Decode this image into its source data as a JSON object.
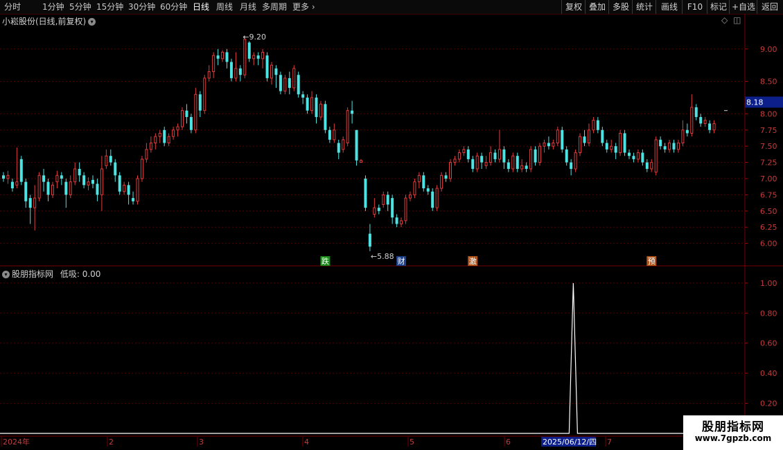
{
  "toolbar": {
    "periods": [
      "分时",
      "1分钟",
      "5分钟",
      "15分钟",
      "30分钟",
      "60分钟",
      "日线",
      "周线",
      "月线",
      "多周期",
      "更多"
    ],
    "active": "日线",
    "right_buttons": [
      "复权",
      "叠加",
      "多股",
      "统计",
      "画线",
      "F10",
      "标记",
      "+自选",
      "返回"
    ]
  },
  "main_chart": {
    "title": "小崧股份(日线,前复权)",
    "y_ticks": [
      "9.00",
      "8.50",
      "8.00",
      "7.75",
      "7.50",
      "7.25",
      "7.00",
      "6.75",
      "6.50",
      "6.25",
      "6.00"
    ],
    "current_price": "8.18",
    "high_label": "9.20",
    "low_label": "5.88",
    "event_tags": [
      {
        "text": "跌",
        "color": "#1a8a1a"
      },
      {
        "text": "财",
        "color": "#1c3f8c"
      },
      {
        "text": "激",
        "color": "#b0541a"
      },
      {
        "text": "预",
        "color": "#b0541a"
      }
    ]
  },
  "indicator": {
    "title": "股朋指标网",
    "value_label": "低吸: 0.00",
    "y_ticks": [
      "1.00",
      "0.80",
      "0.60",
      "0.40",
      "0.20"
    ]
  },
  "x_axis": {
    "labels": [
      "2024年",
      "2",
      "3",
      "4",
      "5",
      "6",
      "2025/06/12/四",
      "7"
    ]
  },
  "watermark": {
    "line1": "股朋指标网",
    "line2": "www.7gpzb.com"
  },
  "chart_data": {
    "type": "candlestick",
    "price_ylim": [
      5.75,
      9.35
    ],
    "candles": [
      [
        7.05,
        7.0,
        7.1,
        6.95
      ],
      [
        7.0,
        7.05,
        7.12,
        6.92
      ],
      [
        6.95,
        6.85,
        7.0,
        6.8
      ],
      [
        6.9,
        6.95,
        7.48,
        6.85
      ],
      [
        7.3,
        6.95,
        7.35,
        6.9
      ],
      [
        6.95,
        6.65,
        7.0,
        6.55
      ],
      [
        6.7,
        6.55,
        6.75,
        6.3
      ],
      [
        6.55,
        6.7,
        6.9,
        6.2
      ],
      [
        6.7,
        7.05,
        7.1,
        6.65
      ],
      [
        7.05,
        6.95,
        7.15,
        6.8
      ],
      [
        6.95,
        6.75,
        7.0,
        6.65
      ],
      [
        6.75,
        6.9,
        6.95,
        6.7
      ],
      [
        6.95,
        7.05,
        7.12,
        6.85
      ],
      [
        7.05,
        7.0,
        7.1,
        6.9
      ],
      [
        6.95,
        6.75,
        7.0,
        6.55
      ],
      [
        6.75,
        6.95,
        7.05,
        6.7
      ],
      [
        6.95,
        7.15,
        7.25,
        6.9
      ],
      [
        7.15,
        7.05,
        7.25,
        6.95
      ],
      [
        7.05,
        6.9,
        7.1,
        6.85
      ],
      [
        6.9,
        6.95,
        7.02,
        6.82
      ],
      [
        6.98,
        6.92,
        7.05,
        6.85
      ],
      [
        6.92,
        6.75,
        7.0,
        6.65
      ],
      [
        6.75,
        7.15,
        7.35,
        6.5
      ],
      [
        7.2,
        7.35,
        7.45,
        7.15
      ],
      [
        7.35,
        7.25,
        7.45,
        7.2
      ],
      [
        7.25,
        7.05,
        7.3,
        6.95
      ],
      [
        7.05,
        6.8,
        7.1,
        6.75
      ],
      [
        6.8,
        6.9,
        6.95,
        6.75
      ],
      [
        6.9,
        6.75,
        6.95,
        6.6
      ],
      [
        6.7,
        6.65,
        6.8,
        6.6
      ],
      [
        6.65,
        7.0,
        7.05,
        6.6
      ],
      [
        7.0,
        7.3,
        7.35,
        6.95
      ],
      [
        7.3,
        7.45,
        7.55,
        7.25
      ],
      [
        7.45,
        7.55,
        7.65,
        7.4
      ],
      [
        7.55,
        7.65,
        7.7,
        7.45
      ],
      [
        7.65,
        7.7,
        7.75,
        7.55
      ],
      [
        7.75,
        7.55,
        7.8,
        7.5
      ],
      [
        7.55,
        7.65,
        7.7,
        7.5
      ],
      [
        7.65,
        7.75,
        7.8,
        7.6
      ],
      [
        7.75,
        7.8,
        7.85,
        7.65
      ],
      [
        7.8,
        8.05,
        8.1,
        7.75
      ],
      [
        8.05,
        7.95,
        8.15,
        7.85
      ],
      [
        7.95,
        7.75,
        8.0,
        7.7
      ],
      [
        7.75,
        8.3,
        8.4,
        7.7
      ],
      [
        8.3,
        8.05,
        8.35,
        7.95
      ],
      [
        8.05,
        8.55,
        8.6,
        8.0
      ],
      [
        8.55,
        8.65,
        8.75,
        8.5
      ],
      [
        8.65,
        8.9,
        8.95,
        8.55
      ],
      [
        8.9,
        8.85,
        9.0,
        8.75
      ],
      [
        8.85,
        8.95,
        8.98,
        8.8
      ],
      [
        8.95,
        8.8,
        9.0,
        8.7
      ],
      [
        8.8,
        8.55,
        8.85,
        8.5
      ],
      [
        8.55,
        8.7,
        8.95,
        8.5
      ],
      [
        8.7,
        8.6,
        8.75,
        8.5
      ],
      [
        8.6,
        9.15,
        9.2,
        8.55
      ],
      [
        9.1,
        8.85,
        9.12,
        8.8
      ],
      [
        8.85,
        8.9,
        8.95,
        8.75
      ],
      [
        8.9,
        8.85,
        8.95,
        8.75
      ],
      [
        8.85,
        8.95,
        9.0,
        8.7
      ],
      [
        8.9,
        8.55,
        8.95,
        8.5
      ],
      [
        8.55,
        8.75,
        8.8,
        8.45
      ],
      [
        8.7,
        8.6,
        8.75,
        8.4
      ],
      [
        8.6,
        8.35,
        8.65,
        8.3
      ],
      [
        8.35,
        8.55,
        8.6,
        8.3
      ],
      [
        8.55,
        8.4,
        8.65,
        8.3
      ],
      [
        8.4,
        8.7,
        8.75,
        8.35
      ],
      [
        8.6,
        8.3,
        8.65,
        8.25
      ],
      [
        8.3,
        8.25,
        8.35,
        8.15
      ],
      [
        8.25,
        8.05,
        8.3,
        8.0
      ],
      [
        8.05,
        8.25,
        8.35,
        8.0
      ],
      [
        8.25,
        7.95,
        8.3,
        7.85
      ],
      [
        7.95,
        8.15,
        8.2,
        7.9
      ],
      [
        8.15,
        7.75,
        8.2,
        7.7
      ],
      [
        7.75,
        7.6,
        7.8,
        7.55
      ],
      [
        7.6,
        7.75,
        7.85,
        7.55
      ],
      [
        7.55,
        7.4,
        7.6,
        7.3
      ],
      [
        7.45,
        7.6,
        7.65,
        7.4
      ],
      [
        7.55,
        8.05,
        8.1,
        7.5
      ],
      [
        8.05,
        8.0,
        8.2,
        7.85
      ],
      [
        7.75,
        7.28,
        7.75,
        7.2
      ],
      [
        7.25,
        7.28,
        7.3,
        7.25
      ],
      [
        7.0,
        6.55,
        7.05,
        6.5
      ],
      [
        6.15,
        5.95,
        6.3,
        5.88
      ],
      [
        6.45,
        6.55,
        6.7,
        6.4
      ],
      [
        6.55,
        6.5,
        6.6,
        6.45
      ],
      [
        6.6,
        6.75,
        6.8,
        6.55
      ],
      [
        6.75,
        6.6,
        6.8,
        6.5
      ],
      [
        6.7,
        6.4,
        6.75,
        6.3
      ],
      [
        6.4,
        6.3,
        6.45,
        6.25
      ],
      [
        6.3,
        6.35,
        6.4,
        6.25
      ],
      [
        6.35,
        6.7,
        6.75,
        6.3
      ],
      [
        6.7,
        6.75,
        6.8,
        6.65
      ],
      [
        6.75,
        6.95,
        7.0,
        6.7
      ],
      [
        6.95,
        7.05,
        7.1,
        6.85
      ],
      [
        7.05,
        6.85,
        7.1,
        6.8
      ],
      [
        6.85,
        6.8,
        6.9,
        6.75
      ],
      [
        6.8,
        6.55,
        6.85,
        6.5
      ],
      [
        6.55,
        6.85,
        6.9,
        6.5
      ],
      [
        6.85,
        7.05,
        7.1,
        6.8
      ],
      [
        7.05,
        7.0,
        7.1,
        6.95
      ],
      [
        7.0,
        7.25,
        7.3,
        6.95
      ],
      [
        7.25,
        7.3,
        7.35,
        7.2
      ],
      [
        7.3,
        7.4,
        7.45,
        7.25
      ],
      [
        7.4,
        7.45,
        7.5,
        7.35
      ],
      [
        7.45,
        7.3,
        7.5,
        7.25
      ],
      [
        7.3,
        7.15,
        7.35,
        7.1
      ],
      [
        7.15,
        7.35,
        7.4,
        7.1
      ],
      [
        7.35,
        7.25,
        7.4,
        7.15
      ],
      [
        7.2,
        7.25,
        7.35,
        7.15
      ],
      [
        7.25,
        7.4,
        7.5,
        7.2
      ],
      [
        7.4,
        7.3,
        7.45,
        7.25
      ],
      [
        7.3,
        7.45,
        7.75,
        7.25
      ],
      [
        7.45,
        7.25,
        7.5,
        7.15
      ],
      [
        7.25,
        7.15,
        7.3,
        7.1
      ],
      [
        7.15,
        7.35,
        7.4,
        7.1
      ],
      [
        7.35,
        7.15,
        7.4,
        7.1
      ],
      [
        7.15,
        7.2,
        7.3,
        7.1
      ],
      [
        7.2,
        7.15,
        7.25,
        7.1
      ],
      [
        7.15,
        7.45,
        7.5,
        7.1
      ],
      [
        7.45,
        7.25,
        7.5,
        7.2
      ],
      [
        7.25,
        7.5,
        7.55,
        7.2
      ],
      [
        7.5,
        7.55,
        7.6,
        7.4
      ],
      [
        7.55,
        7.5,
        7.65,
        7.45
      ],
      [
        7.5,
        7.55,
        7.6,
        7.45
      ],
      [
        7.55,
        7.75,
        7.8,
        7.5
      ],
      [
        7.75,
        7.45,
        7.8,
        7.4
      ],
      [
        7.45,
        7.25,
        7.5,
        7.2
      ],
      [
        7.25,
        7.15,
        7.3,
        7.05
      ],
      [
        7.15,
        7.4,
        7.45,
        7.1
      ],
      [
        7.4,
        7.65,
        7.7,
        7.35
      ],
      [
        7.65,
        7.55,
        7.75,
        7.5
      ],
      [
        7.55,
        7.75,
        7.85,
        7.5
      ],
      [
        7.75,
        7.9,
        7.95,
        7.7
      ],
      [
        7.9,
        7.75,
        7.95,
        7.7
      ],
      [
        7.75,
        7.55,
        7.8,
        7.5
      ],
      [
        7.55,
        7.45,
        7.6,
        7.4
      ],
      [
        7.45,
        7.5,
        7.6,
        7.4
      ],
      [
        7.5,
        7.4,
        7.55,
        7.3
      ],
      [
        7.4,
        7.7,
        7.75,
        7.35
      ],
      [
        7.7,
        7.4,
        7.75,
        7.35
      ],
      [
        7.4,
        7.35,
        7.45,
        7.3
      ],
      [
        7.35,
        7.3,
        7.4,
        7.25
      ],
      [
        7.3,
        7.4,
        7.45,
        7.25
      ],
      [
        7.4,
        7.25,
        7.45,
        7.2
      ],
      [
        7.25,
        7.15,
        7.3,
        7.1
      ],
      [
        7.15,
        7.25,
        7.3,
        7.1
      ],
      [
        7.1,
        7.6,
        7.65,
        7.05
      ],
      [
        7.6,
        7.5,
        7.65,
        7.45
      ],
      [
        7.5,
        7.45,
        7.55,
        7.4
      ],
      [
        7.45,
        7.55,
        7.6,
        7.4
      ],
      [
        7.55,
        7.45,
        7.6,
        7.4
      ],
      [
        7.45,
        7.55,
        7.6,
        7.4
      ],
      [
        7.55,
        7.75,
        7.9,
        7.5
      ],
      [
        7.75,
        7.7,
        7.85,
        7.65
      ],
      [
        7.7,
        8.1,
        8.3,
        7.65
      ],
      [
        8.1,
        7.95,
        8.15,
        7.9
      ],
      [
        7.95,
        7.85,
        8.0,
        7.8
      ],
      [
        7.85,
        7.9,
        7.95,
        7.8
      ],
      [
        7.85,
        7.75,
        7.9,
        7.7
      ],
      [
        7.75,
        7.85,
        7.9,
        7.7
      ]
    ],
    "indicator_series": [
      {
        "name": "低吸",
        "peak_value": 1.0,
        "peak_date": "2025/06/12/四"
      }
    ],
    "indicator_ylim": [
      0,
      1.05
    ]
  }
}
